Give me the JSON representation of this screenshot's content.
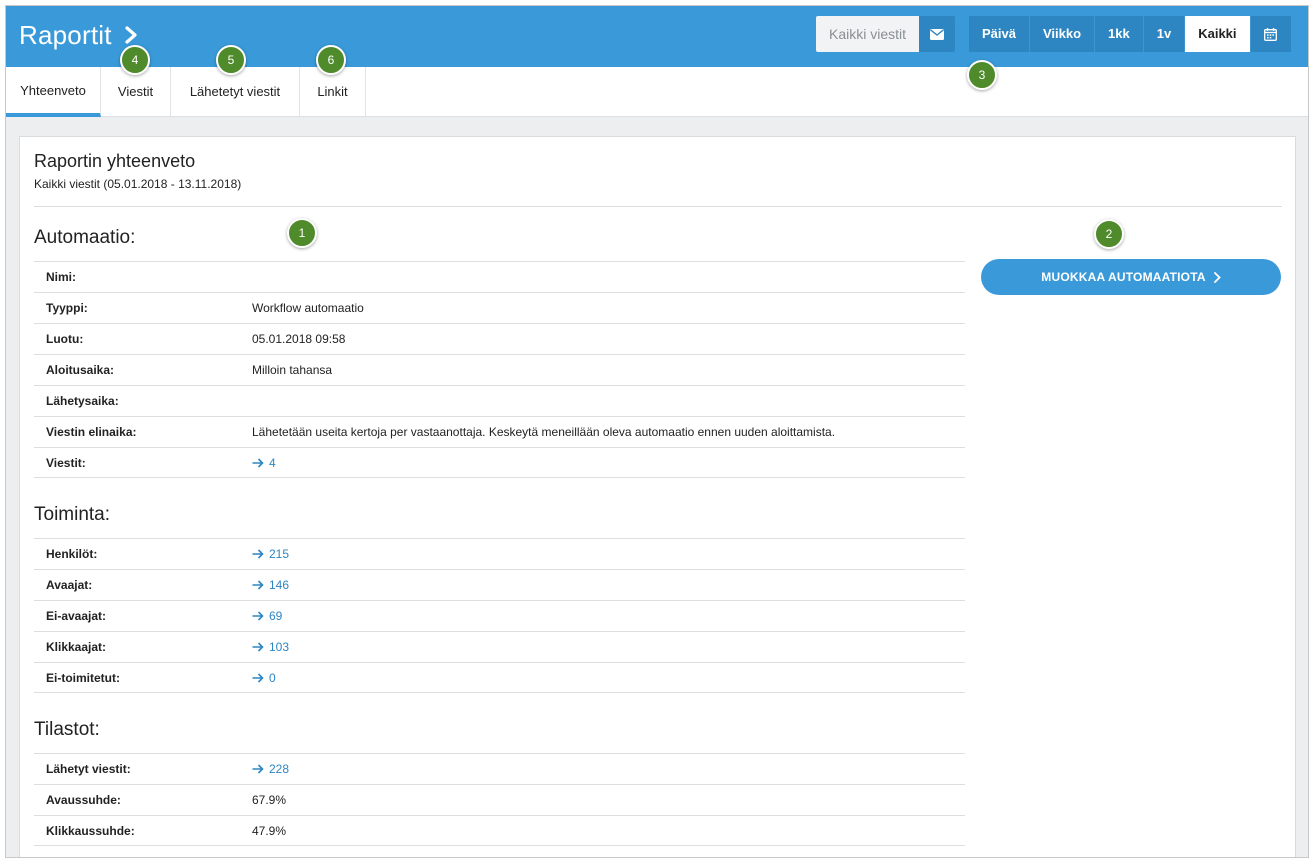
{
  "header": {
    "title": "Raportit",
    "message_filter": "Kaikki viestit",
    "periods": [
      "Päivä",
      "Viikko",
      "1kk",
      "1v",
      "Kaikki"
    ],
    "active_period": "Kaikki"
  },
  "tabs": [
    "Yhteenveto",
    "Viestit",
    "Lähetetyt viestit",
    "Linkit"
  ],
  "active_tab": "Yhteenveto",
  "summary": {
    "title": "Raportin yhteenveto",
    "subtitle": "Kaikki viestit (05.01.2018 - 13.11.2018)"
  },
  "automation": {
    "heading": "Automaatio:",
    "rows": [
      {
        "label": "Nimi:",
        "value": ""
      },
      {
        "label": "Tyyppi:",
        "value": "Workflow automaatio"
      },
      {
        "label": "Luotu:",
        "value": "05.01.2018 09:58"
      },
      {
        "label": "Aloitusaika:",
        "value": "Milloin tahansa"
      },
      {
        "label": "Lähetysaika:",
        "value": ""
      },
      {
        "label": "Viestin elinaika:",
        "value": "Lähetetään useita kertoja per vastaanottaja. Keskeytä meneillään oleva automaatio ennen uuden aloittamista."
      },
      {
        "label": "Viestit:",
        "value": "4"
      }
    ],
    "edit_button": "MUOKKAA AUTOMAATIOTA"
  },
  "activity": {
    "heading": "Toiminta:",
    "rows": [
      {
        "label": "Henkilöt:",
        "value": "215"
      },
      {
        "label": "Avaajat:",
        "value": "146"
      },
      {
        "label": "Ei-avaajat:",
        "value": "69"
      },
      {
        "label": "Klikkaajat:",
        "value": "103"
      },
      {
        "label": "Ei-toimitetut:",
        "value": "0"
      }
    ]
  },
  "stats": {
    "heading": "Tilastot:",
    "rows": [
      {
        "label": "Lähetyt viestit:",
        "value": "228"
      },
      {
        "label": "Avaussuhde:",
        "value": "67.9%"
      },
      {
        "label": "Klikkaussuhde:",
        "value": "47.9%"
      }
    ]
  },
  "callouts": [
    "1",
    "2",
    "3",
    "4",
    "5",
    "6"
  ],
  "colors": {
    "accent": "#3a9ad9",
    "callout": "#4f8a2b",
    "link": "#2d86c2"
  }
}
